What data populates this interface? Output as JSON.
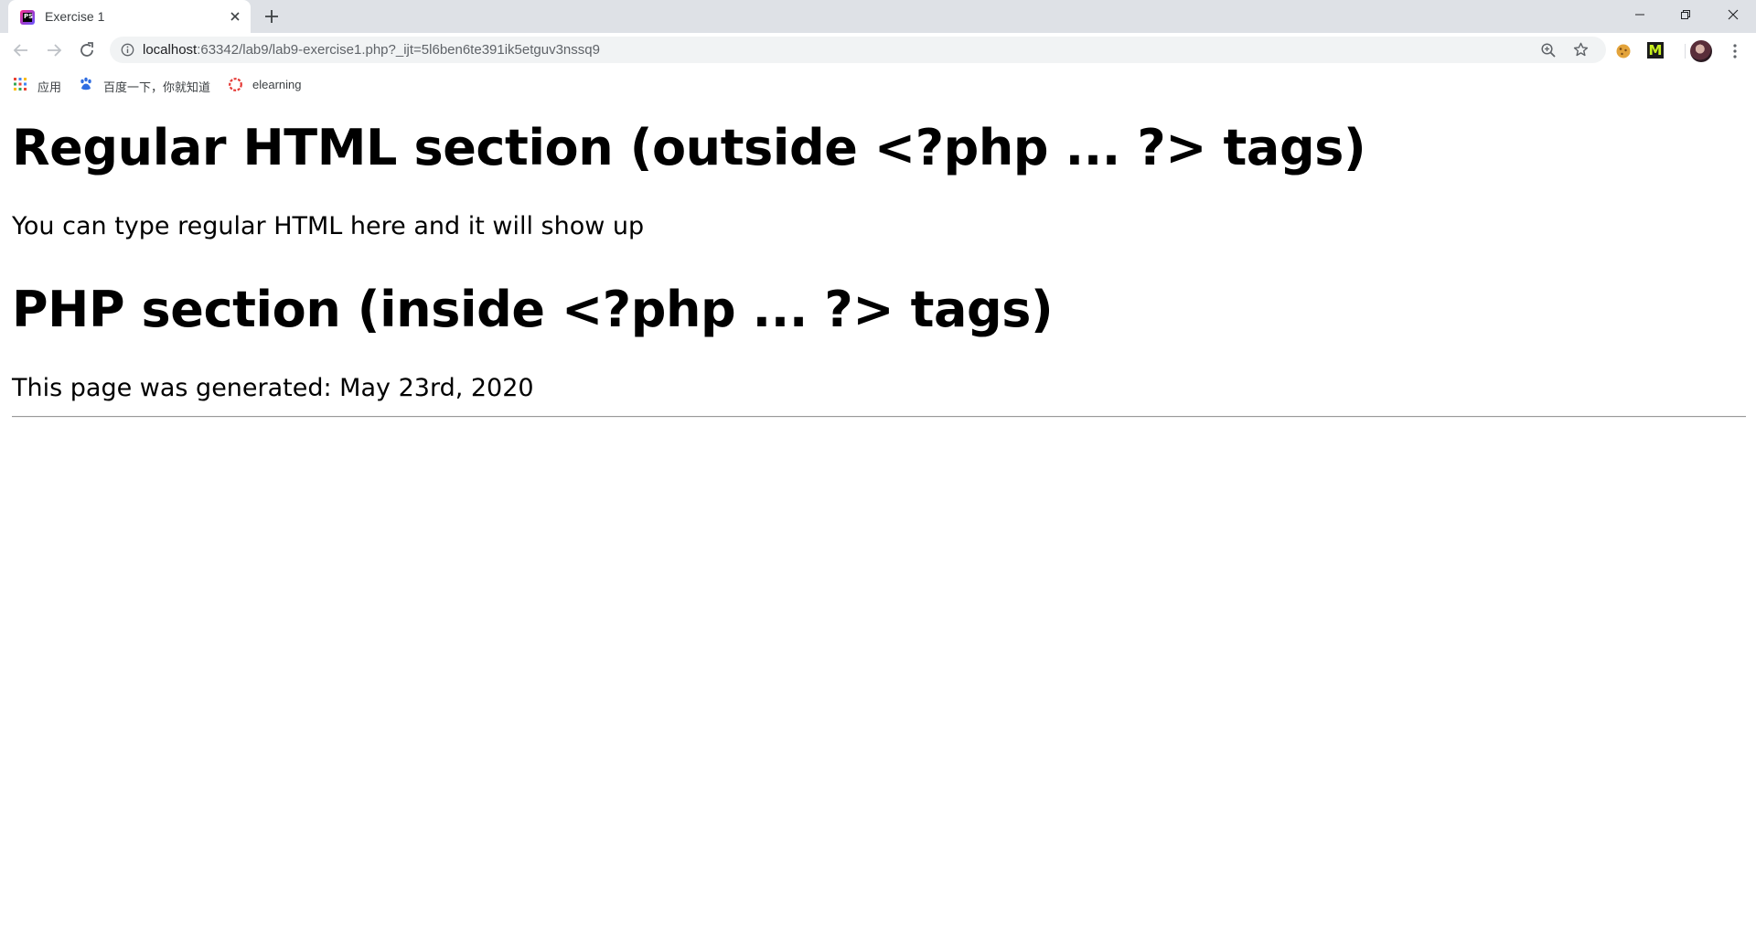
{
  "browser": {
    "tab": {
      "title": "Exercise 1",
      "favicon_icon": "phpstorm-icon"
    },
    "omnibox": {
      "url_host": "localhost",
      "url_rest": ":63342/lab9/lab9-exercise1.php?_ijt=5l6ben6te391ik5etguv3nssq9"
    },
    "bookmarks": [
      {
        "label": "应用",
        "icon": "apps-grid-icon"
      },
      {
        "label": "百度一下，你就知道",
        "icon": "baidu-paw-icon"
      },
      {
        "label": "elearning",
        "icon": "elearning-ring-icon"
      }
    ],
    "extensions": {
      "ext2_letter": "M"
    }
  },
  "page": {
    "heading1": "Regular HTML section (outside <?php ... ?> tags)",
    "paragraph1": "You can type regular HTML here and it will show up",
    "heading2": "PHP section (inside <?php ... ?> tags)",
    "paragraph2": "This page was generated: May 23rd, 2020"
  }
}
